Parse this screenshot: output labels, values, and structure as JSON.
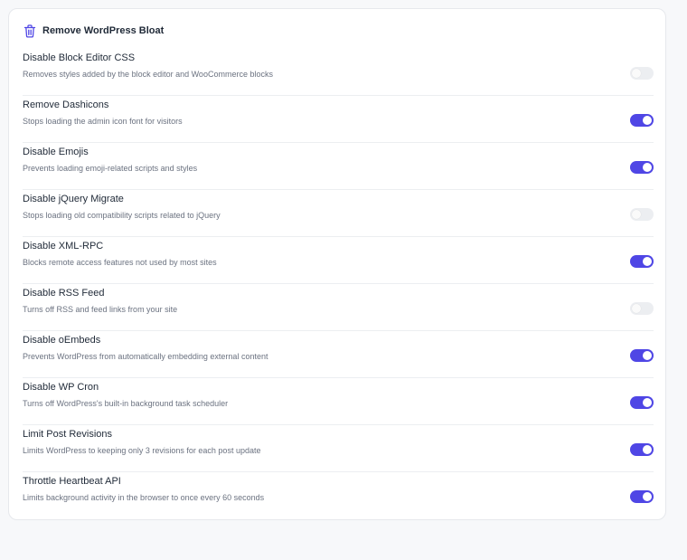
{
  "card": {
    "title": "Remove WordPress Bloat",
    "icon": "trash-icon"
  },
  "colors": {
    "accent": "#4f46e5",
    "toggle_off": "#eceef1"
  },
  "settings": [
    {
      "label": "Disable Block Editor CSS",
      "description": "Removes styles added by the block editor and WooCommerce blocks",
      "enabled": false
    },
    {
      "label": "Remove Dashicons",
      "description": "Stops loading the admin icon font for visitors",
      "enabled": true
    },
    {
      "label": "Disable Emojis",
      "description": "Prevents loading emoji-related scripts and styles",
      "enabled": true
    },
    {
      "label": "Disable jQuery Migrate",
      "description": "Stops loading old compatibility scripts related to jQuery",
      "enabled": false
    },
    {
      "label": "Disable XML-RPC",
      "description": "Blocks remote access features not used by most sites",
      "enabled": true
    },
    {
      "label": "Disable RSS Feed",
      "description": "Turns off RSS and feed links from your site",
      "enabled": false
    },
    {
      "label": "Disable oEmbeds",
      "description": "Prevents WordPress from automatically embedding external content",
      "enabled": true
    },
    {
      "label": "Disable WP Cron",
      "description": "Turns off WordPress's built-in background task scheduler",
      "enabled": true
    },
    {
      "label": "Limit Post Revisions",
      "description": "Limits WordPress to keeping only 3 revisions for each post update",
      "enabled": true
    },
    {
      "label": "Throttle Heartbeat API",
      "description": "Limits background activity in the browser to once every 60 seconds",
      "enabled": true
    }
  ]
}
